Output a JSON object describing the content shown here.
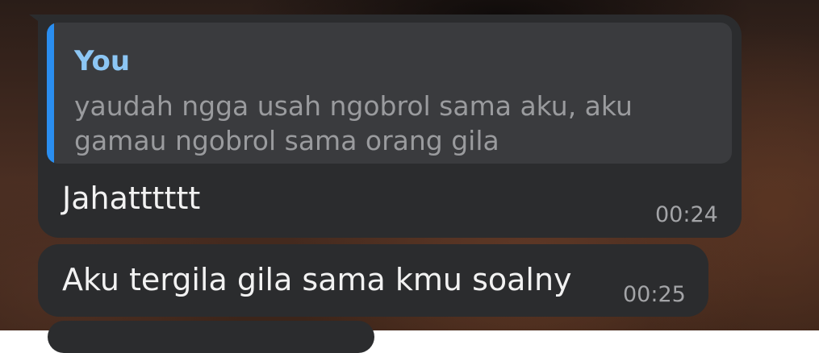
{
  "messages": [
    {
      "reply": {
        "author": "You",
        "text": "yaudah ngga usah ngobrol sama aku, aku gamau ngobrol sama orang gila"
      },
      "text": "Jahatttttt",
      "time": "00:24"
    },
    {
      "text": "Aku tergila gila sama kmu soalny",
      "time": "00:25"
    }
  ],
  "colors": {
    "bubble": "#2b2c2e",
    "reply_box": "#3a3b3e",
    "reply_accent": "#2a8ef0",
    "reply_author": "#8cc6f4",
    "text": "#f2f2f2",
    "time": "#a3a4a7"
  }
}
